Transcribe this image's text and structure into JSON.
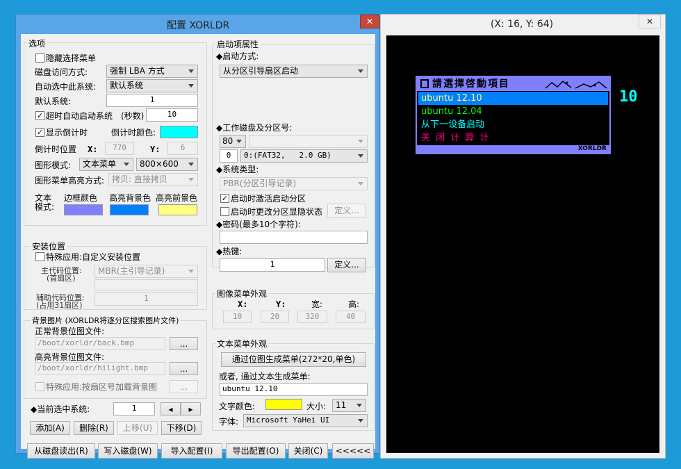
{
  "config_window": {
    "title": "配置 XORLDR",
    "close_glyph": "✕",
    "options": {
      "legend": "选项",
      "hide_menu_label": "隐藏选择菜单",
      "disk_access_label": "磁盘访问方式:",
      "disk_access_value": "强制 LBA 方式",
      "auto_select_label": "自动选中此系统:",
      "auto_select_value": "默认系统",
      "default_system_label": "默认系统:",
      "default_system_value": "1",
      "timeout_label": "超时自动启动系统",
      "seconds_label": "(秒数)",
      "seconds_value": "10",
      "show_countdown_label": "显示倒计时",
      "countdown_color_label": "倒计时颜色:",
      "countdown_pos_label": "倒计时位置",
      "x_label": "X:",
      "x_value": "770",
      "y_label": "Y:",
      "y_value": "6",
      "graphic_mode_label": "图形模式:",
      "graphic_mode_value": "文本菜单",
      "resolution_value": "800×600",
      "highlight_mode_label": "图形菜单高亮方式:",
      "highlight_mode_value": "拷贝: 直接拷贝",
      "text_mode_label_1": "文本",
      "text_mode_label_2": "模式:",
      "border_color_label": "边框颜色",
      "hl_bg_label": "高亮背景色",
      "hl_fg_label": "高亮前景色"
    },
    "install": {
      "legend": "安装位置",
      "special_label": "特殊应用:自定义安装位置",
      "main_code_label_1": "主代码位置:",
      "main_code_label_2": "(首扇区)",
      "main_code_value": "MBR(主引导记录)",
      "aux_code_label_1": "辅助代码位置:",
      "aux_code_label_2": "(占用31扇区)",
      "aux_code_value": "1"
    },
    "background": {
      "legend": "背景图片 (XORLDR将逐分区搜索图片文件)",
      "normal_label": "正常背景位图文件:",
      "normal_value": "/boot/xorldr/back.bmp",
      "highlight_label": "高亮背景位图文件:",
      "highlight_value": "/boot/xorldr/hilight.bmp",
      "browse": "...",
      "special_label": "特殊应用:按扇区号加载背景图"
    },
    "current": {
      "label": "◆当前选中系统:",
      "value": "1",
      "prev": "◂",
      "next": "▸"
    },
    "row_buttons": {
      "add": "添加(A)",
      "delete": "删除(R)",
      "up": "上移(U)",
      "down": "下移(D)"
    },
    "bottom_buttons": {
      "read": "从磁盘读出(R)",
      "write": "写入磁盘(W)",
      "import": "导入配置(I)",
      "export": "导出配置(O)",
      "close": "关闭(C)",
      "collapse": "<<<<<"
    },
    "boot": {
      "legend": "启动项属性",
      "method_label": "◆启动方式:",
      "method_value": "从分区引导扇区启动",
      "disk_label": "◆工作磁盘及分区号:",
      "disk_value": "80",
      "part_num": "0",
      "part_value": "0:(FAT32,   2.0 GB)",
      "systype_label": "◆系统类型:",
      "systype_value": "PBR(分区引导记录)",
      "activate_label": "启动时激活启动分区",
      "hide_label": "启动时更改分区显隐状态",
      "define_btn": "定义...",
      "password_label": "◆密码(最多10个字符):",
      "password_value": "",
      "hotkey_label": "◆热键:",
      "hotkey_value": "1",
      "hotkey_btn": "定义..."
    },
    "image_menu": {
      "legend": "图像菜单外观",
      "x_label": "X:",
      "y_label": "Y:",
      "w_label": "宽:",
      "h_label": "高:",
      "x_value": "10",
      "y_value": "20",
      "w_value": "320",
      "h_value": "40"
    },
    "text_menu": {
      "legend": "文本菜单外观",
      "gen_btn": "通过位图生成菜单(272*20,单色)",
      "or_label": "或者, 通过文本生成菜单:",
      "text_value": "ubuntu 12.10",
      "color_label": "文字颜色:",
      "size_label": "大小:",
      "size_value": "11",
      "font_label": "字体:",
      "font_value": "Microsoft YaHei UI"
    }
  },
  "preview_window": {
    "title": "(X: 16, Y: 64)",
    "close_glyph": "✕",
    "menu_title": "請選擇啓動項目",
    "menu_brand": "XORLDR",
    "countdown": "10",
    "items": [
      "ubuntu 12.10",
      "ubuntu 12.04",
      "从下一设备启动",
      "关 闭 计 算 计"
    ]
  },
  "colors": {
    "countdown": "#00ffff",
    "border": "#8080ff",
    "highlight_bg": "#0080ff",
    "highlight_fg": "#ffff80",
    "text_color": "#ffff00"
  }
}
